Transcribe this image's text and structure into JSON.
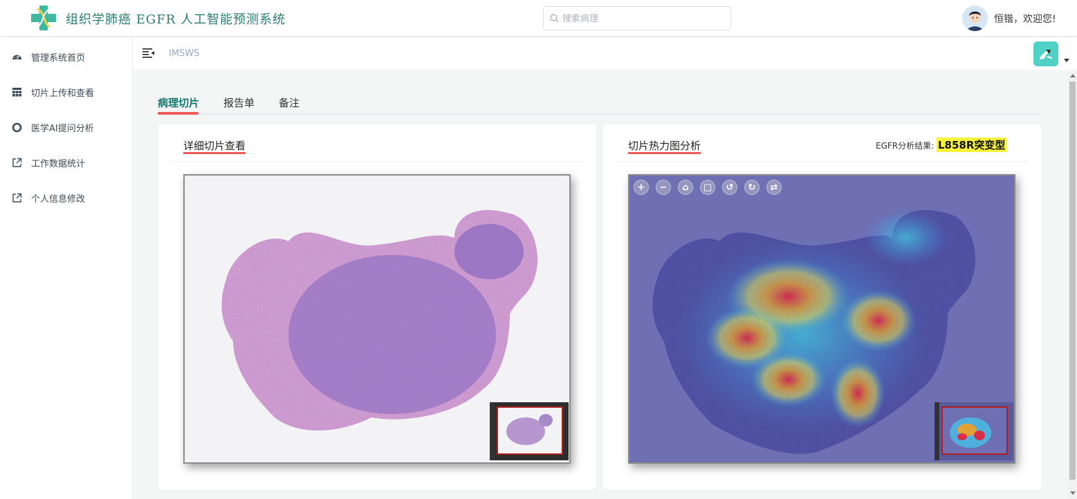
{
  "header": {
    "app_title": "组织学肺癌 EGFR 人工智能预测系统",
    "search_placeholder": "搜索病理",
    "welcome": "恒锴，欢迎您!"
  },
  "sidebar": {
    "items": [
      {
        "label": "管理系统首页",
        "icon": "dashboard-icon"
      },
      {
        "label": "切片上传和查看",
        "icon": "grid-icon"
      },
      {
        "label": "医学AI提问分析",
        "icon": "circle-icon"
      },
      {
        "label": "工作数据统计",
        "icon": "external-link-icon"
      },
      {
        "label": "个人信息修改",
        "icon": "external-link-icon"
      }
    ]
  },
  "topbar": {
    "breadcrumb": "IMSWS"
  },
  "tabs": [
    {
      "label": "病理切片",
      "active": true
    },
    {
      "label": "报告单",
      "active": false
    },
    {
      "label": "备注",
      "active": false
    }
  ],
  "left_card": {
    "title": "详细切片查看"
  },
  "right_card": {
    "title": "切片热力图分析",
    "result_label": "EGFR分析结果:",
    "result_value": "L858R突变型",
    "toolbar_icons": [
      "zoom-in-icon",
      "zoom-out-icon",
      "home-icon",
      "fullscreen-icon",
      "rotate-left-icon",
      "rotate-right-icon",
      "flip-icon"
    ]
  },
  "colors": {
    "brand": "#2a7d6e",
    "tab_active": "#12786f",
    "accent_underline": "#f05a5a",
    "result_highlight": "#f6f33a",
    "tool_button": "#4fd1c5"
  }
}
